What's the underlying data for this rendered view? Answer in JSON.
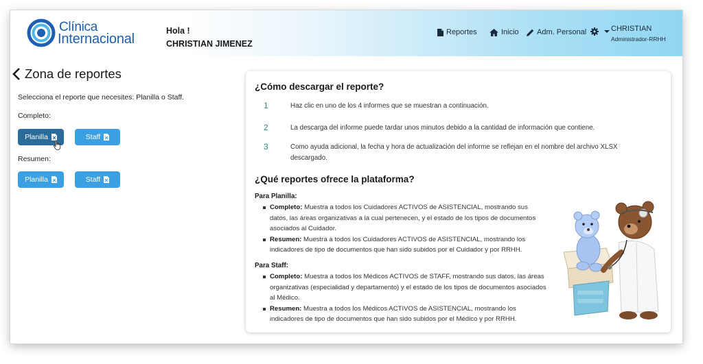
{
  "header": {
    "logo": {
      "line1": "Clínica",
      "line2": "Internacional"
    },
    "greeting": "Hola !",
    "user_full_name": "CHRISTIAN JIMENEZ",
    "nav": {
      "reportes": "Reportes",
      "inicio": "Inicio",
      "adm_personal": "Adm. Personal"
    },
    "user": {
      "name": "CHRISTIAN",
      "role": "Administrador-RRHH"
    }
  },
  "left": {
    "title": "Zona de reportes",
    "subtitle": "Selecciona el reporte que necesites: Planilla o Staff.",
    "completo_label": "Completo:",
    "resumen_label": "Resumen:",
    "buttons": {
      "completo_planilla": "Planilla",
      "completo_staff": "Staff",
      "resumen_planilla": "Planilla",
      "resumen_staff": "Staff"
    }
  },
  "card": {
    "how_title": "¿Cómo descargar el reporte?",
    "steps": [
      {
        "num": "1",
        "text": "Haz clic en uno de los 4 informes que se muestran a continuación."
      },
      {
        "num": "2",
        "text": "La descarga del informe puede tardar unos minutos debido a la cantidad de información que contiene."
      },
      {
        "num": "3",
        "text": "Como ayuda adicional, la fecha y hora de actualización del informe se reflejan en el nombre del archivo XLSX descargado."
      }
    ],
    "what_title": "¿Qué reportes ofrece la plataforma?",
    "planilla": {
      "title": "Para Planilla:",
      "items": [
        {
          "label": "Completo:",
          "text": " Muestra a todos los Cuidadores ACTIVOS de ASISTENCIAL, mostrando sus datos, las áreas organizativas a la cual pertenecen, y el estado de los tipos de documentos asociados al Cuidador."
        },
        {
          "label": "Resumen:",
          "text": " Muestra a todos los Cuidadores ACTIVOS de ASISTENCIAL, mostrando los indicadores de tipo de documentos que han sido subidos por el Cuidador y por RRHH."
        }
      ]
    },
    "staff": {
      "title": "Para Staff:",
      "items": [
        {
          "label": "Completo:",
          "text": " Muestra a todos los Médicos ACTIVOS de STAFF, mostrando sus datos, las áreas organizativas (especialidad y departamento) y el estado de los tipos de documentos asociados al Médico."
        },
        {
          "label": "Resumen:",
          "text": " Muestra a todos los Médicos ACTIVOS de ASISTENCIAL, mostrando los indicadores de tipo de documentos que han sido subidos por el Médico y por RRHH."
        }
      ]
    }
  },
  "colors": {
    "brand_blue": "#1d5fb0",
    "button_blue": "#3aa0e2",
    "button_active": "#2a6b9a",
    "step_number": "#2e8a8a"
  },
  "icons": [
    "file-icon",
    "home-icon",
    "pencil-icon",
    "gear-icon",
    "chevron-down-icon",
    "back-chevron-icon",
    "excel-file-icon",
    "hand-cursor-icon"
  ]
}
